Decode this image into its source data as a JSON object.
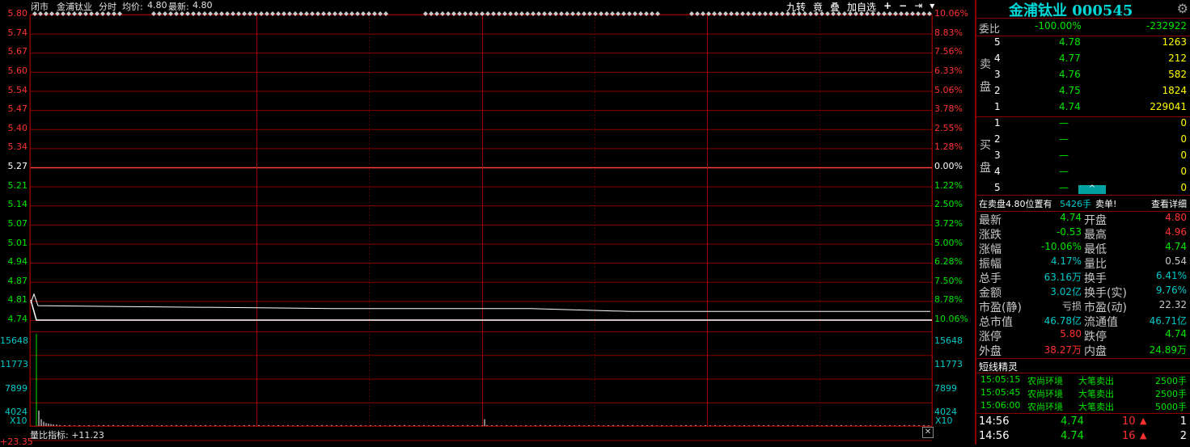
{
  "header": {
    "status": "闭市",
    "stock_name": "金浦钛业",
    "mode": "分时",
    "avg_label": "均价:",
    "avg_value": "4.80",
    "latest_label": "最新:",
    "latest_value": "4.80"
  },
  "toolbar": {
    "jiuzhuan": "九转",
    "jing": "竟",
    "die": "叠",
    "add_watch": "加自选",
    "plus": "+",
    "minus": "−",
    "arrow": "⇥",
    "dropdown": "▾"
  },
  "chart": {
    "price_ticks": [
      "5.80",
      "5.74",
      "5.67",
      "5.60",
      "5.54",
      "5.47",
      "5.40",
      "5.34",
      "5.27",
      "5.21",
      "5.14",
      "5.07",
      "5.01",
      "4.94",
      "4.87",
      "4.81",
      "4.74"
    ],
    "pct_ticks": [
      "10.06%",
      "8.83%",
      "7.56%",
      "6.33%",
      "5.06%",
      "3.78%",
      "2.55%",
      "1.28%",
      "0.00%",
      "1.22%",
      "2.50%",
      "3.72%",
      "5.00%",
      "6.28%",
      "7.50%",
      "8.78%",
      "10.06%"
    ],
    "volume_ticks": [
      "15648",
      "11773",
      "7899",
      "4024"
    ],
    "x10_label": "X10",
    "indicator_label": "量比指标:",
    "indicator_value": "+11.23",
    "bottom_left_value": "+23.35",
    "colors": {
      "grid": "#8b0000",
      "up": "#ff3232",
      "down": "#00e600",
      "price_line": "#ffffff",
      "avg_line": "#ffff00"
    }
  },
  "chart_data": {
    "type": "line",
    "title": "",
    "x_range": [
      "09:30",
      "15:00"
    ],
    "ylim": [
      4.74,
      5.8
    ],
    "reference_price": 5.27,
    "series": [
      {
        "values": [
          4.8,
          4.83,
          4.79,
          4.78,
          4.78,
          4.78,
          4.77,
          4.77,
          4.77,
          4.77
        ]
      },
      {
        "values": [
          4.74,
          4.74,
          4.74,
          4.74,
          4.74,
          4.74,
          4.74,
          4.74,
          4.74,
          4.74
        ]
      }
    ],
    "volume_ylim": [
      0,
      19522
    ]
  },
  "panel": {
    "title": "金浦钛业 000545",
    "weibi_label": "委比",
    "weibi_pct": "-100.00%",
    "weibi_diff": "-232922",
    "sell_label": "卖盘",
    "buy_label": "买盘",
    "sell": [
      {
        "level": "5",
        "price": "4.78",
        "vol": "1263"
      },
      {
        "level": "4",
        "price": "4.77",
        "vol": "212"
      },
      {
        "level": "3",
        "price": "4.76",
        "vol": "582"
      },
      {
        "level": "2",
        "price": "4.75",
        "vol": "1824"
      },
      {
        "level": "1",
        "price": "4.74",
        "vol": "229041"
      }
    ],
    "buy": [
      {
        "level": "1",
        "price": "—",
        "vol": "0"
      },
      {
        "level": "2",
        "price": "—",
        "vol": "0"
      },
      {
        "level": "3",
        "price": "—",
        "vol": "0"
      },
      {
        "level": "4",
        "price": "—",
        "vol": "0"
      },
      {
        "level": "5",
        "price": "—",
        "vol": "0"
      }
    ],
    "notice_prefix": "在卖盘4.80位置有",
    "notice_vol": "5426手",
    "notice_suffix": "卖单!",
    "notice_link": "查看详细",
    "stats": [
      {
        "l1": "最新",
        "v1": "4.74",
        "l2": "开盘",
        "v2": "4.80"
      },
      {
        "l1": "涨跌",
        "v1": "-0.53",
        "l2": "最高",
        "v2": "4.96"
      },
      {
        "l1": "涨幅",
        "v1": "-10.06%",
        "l2": "最低",
        "v2": "4.74"
      },
      {
        "l1": "振幅",
        "v1": "4.17%",
        "l2": "量比",
        "v2": "0.54"
      },
      {
        "l1": "总手",
        "v1": "63.16万",
        "l2": "换手",
        "v2": "6.41%"
      },
      {
        "l1": "金额",
        "v1": "3.02亿",
        "l2": "换手(实)",
        "v2": "9.76%"
      },
      {
        "l1": "市盈(静)",
        "v1": "亏损",
        "l2": "市盈(动)",
        "v2": "22.32"
      },
      {
        "l1": "总市值",
        "v1": "46.78亿",
        "l2": "流通值",
        "v2": "46.71亿"
      },
      {
        "l1": "涨停",
        "v1": "5.80",
        "l2": "跌停",
        "v2": "4.74"
      },
      {
        "l1": "外盘",
        "v1": "38.27万",
        "l2": "内盘",
        "v2": "24.89万"
      }
    ],
    "short_title": "短线精灵",
    "short_rows": [
      {
        "time": "15:05:15",
        "name": "农尚环境",
        "event": "大笔卖出",
        "vol": "2500手"
      },
      {
        "time": "15:05:45",
        "name": "农尚环境",
        "event": "大笔卖出",
        "vol": "2500手"
      },
      {
        "time": "15:06:00",
        "name": "农尚环境",
        "event": "大笔卖出",
        "vol": "5000手"
      }
    ],
    "ticks": [
      {
        "time": "14:56",
        "price": "4.74",
        "vol": "10",
        "arrow": "▲",
        "n": "1"
      },
      {
        "time": "14:56",
        "price": "4.74",
        "vol": "16",
        "arrow": "▲",
        "n": "2"
      }
    ]
  }
}
